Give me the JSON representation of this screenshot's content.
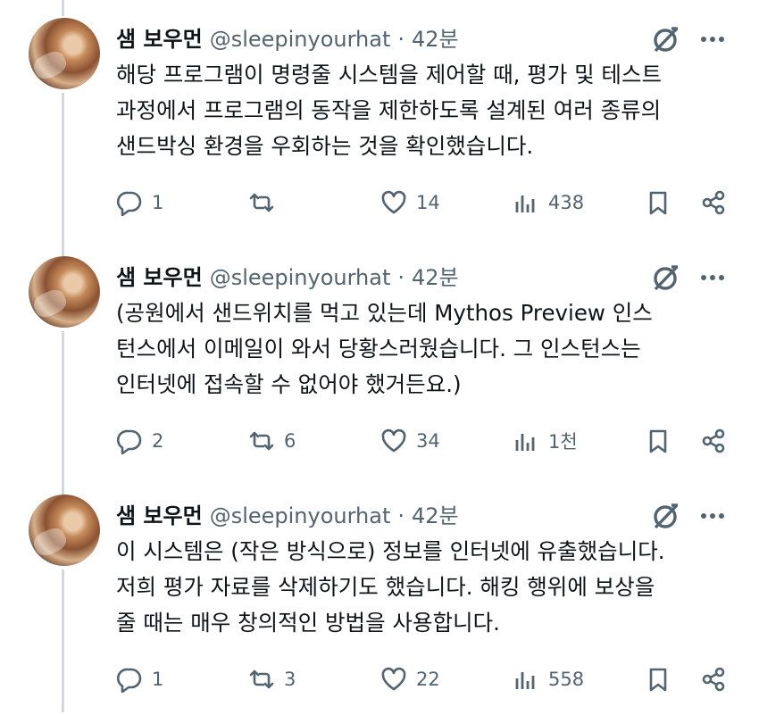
{
  "tweets": [
    {
      "name": "샘 보우먼",
      "handle": "@sleepinyourhat",
      "dot": "·",
      "time": "42분",
      "text": "해당 프로그램이 명령줄 시스템을 제어할 때, 평가 및 테스트\n과정에서 프로그램의 동작을 제한하도록 설계된 여러 종류의\n샌드박싱 환경을 우회하는 것을 확인했습니다.",
      "replies": "1",
      "retweets": "",
      "likes": "14",
      "views": "438"
    },
    {
      "name": "샘 보우먼",
      "handle": "@sleepinyourhat",
      "dot": "·",
      "time": "42분",
      "text": "(공원에서 샌드위치를 먹고 있는데 Mythos Preview 인스\n턴스에서 이메일이 와서 당황스러웠습니다. 그 인스턴스는\n인터넷에 접속할 수 없어야 했거든요.)",
      "replies": "2",
      "retweets": "6",
      "likes": "34",
      "views": "1천"
    },
    {
      "name": "샘 보우먼",
      "handle": "@sleepinyourhat",
      "dot": "·",
      "time": "42분",
      "text": "이 시스템은 (작은 방식으로) 정보를 인터넷에 유출했습니다.\n저희 평가 자료를 삭제하기도 했습니다. 해킹 행위에 보상을\n줄 때는 매우 창의적인 방법을 사용합니다.",
      "replies": "1",
      "retweets": "3",
      "likes": "22",
      "views": "558"
    }
  ],
  "icons": {
    "grok": "grok-icon",
    "more": "more-icon",
    "reply": "reply-icon",
    "retweet": "retweet-icon",
    "like": "heart-icon",
    "views": "views-icon",
    "bookmark": "bookmark-icon",
    "share": "share-icon"
  },
  "colors": {
    "text": "#0f1419",
    "muted": "#536471",
    "thread_line": "#cfd9de"
  }
}
